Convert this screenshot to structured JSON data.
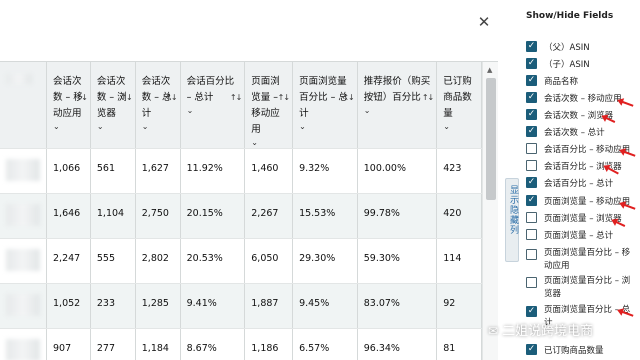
{
  "colors": {
    "accent": "#1b5d7a",
    "header_bg": "#eef1f2",
    "alt_row_bg": "#f0f4f4",
    "annotation": "#e02020"
  },
  "icons": {
    "close": "close-icon",
    "sort": "sort-arrows-icon",
    "caret": "chevron-down-icon",
    "checkbox": "checkmark-icon",
    "watermark": "wechat-icon"
  },
  "table": {
    "columns": [
      {
        "label": "会话次数 – 移动应用"
      },
      {
        "label": "会话次数 – 浏览器"
      },
      {
        "label": "会话次数 – 总计"
      },
      {
        "label": "会话百分比 – 总计"
      },
      {
        "label": "页面浏览量 – 移动应用"
      },
      {
        "label": "页面浏览量百分比 – 总计"
      },
      {
        "label": "推荐报价（购买按钮）百分比"
      },
      {
        "label": "已订购商品数量"
      }
    ],
    "rows": [
      {
        "c1": "1,066",
        "c2": "561",
        "c3": "1,627",
        "c4": "11.92%",
        "c5": "1,460",
        "c6": "9.32%",
        "c7": "100.00%",
        "c8": "423"
      },
      {
        "c1": "1,646",
        "c2": "1,104",
        "c3": "2,750",
        "c4": "20.15%",
        "c5": "2,267",
        "c6": "15.53%",
        "c7": "99.78%",
        "c8": "420"
      },
      {
        "c1": "2,247",
        "c2": "555",
        "c3": "2,802",
        "c4": "20.53%",
        "c5": "6,050",
        "c6": "29.30%",
        "c7": "59.30%",
        "c8": "114"
      },
      {
        "c1": "1,052",
        "c2": "233",
        "c3": "1,285",
        "c4": "9.41%",
        "c5": "1,887",
        "c6": "9.45%",
        "c7": "83.07%",
        "c8": "92"
      },
      {
        "c1": "907",
        "c2": "277",
        "c3": "1,184",
        "c4": "8.67%",
        "c5": "1,186",
        "c6": "6.57%",
        "c7": "96.34%",
        "c8": "81"
      }
    ]
  },
  "side_tab": {
    "label": "显示隐藏列"
  },
  "fields": {
    "title": "Show/Hide Fields",
    "items": [
      {
        "label": "（父）ASIN",
        "checked": true
      },
      {
        "label": "（子）ASIN",
        "checked": true
      },
      {
        "label": "商品名称",
        "checked": true
      },
      {
        "label": "会话次数 – 移动应用",
        "checked": true
      },
      {
        "label": "会话次数 – 浏览器",
        "checked": true
      },
      {
        "label": "会话次数 – 总计",
        "checked": true
      },
      {
        "label": "会话百分比 – 移动应用",
        "checked": false
      },
      {
        "label": "会话百分比 – 浏览器",
        "checked": false
      },
      {
        "label": "会话百分比 – 总计",
        "checked": true
      },
      {
        "label": "页面浏览量 – 移动应用",
        "checked": true
      },
      {
        "label": "页面浏览量 – 浏览器",
        "checked": false
      },
      {
        "label": "页面浏览量 – 总计",
        "checked": false
      },
      {
        "label": "页面浏览量百分比 – 移动应用",
        "checked": false
      },
      {
        "label": "页面浏览量百分比 – 浏览器",
        "checked": false
      },
      {
        "label": "页面浏览量百分比 – 总计",
        "checked": true
      },
      {
        "label": "已订购商品数量",
        "checked": true
      }
    ]
  },
  "watermark": {
    "text": "二姐说跨境电商"
  }
}
